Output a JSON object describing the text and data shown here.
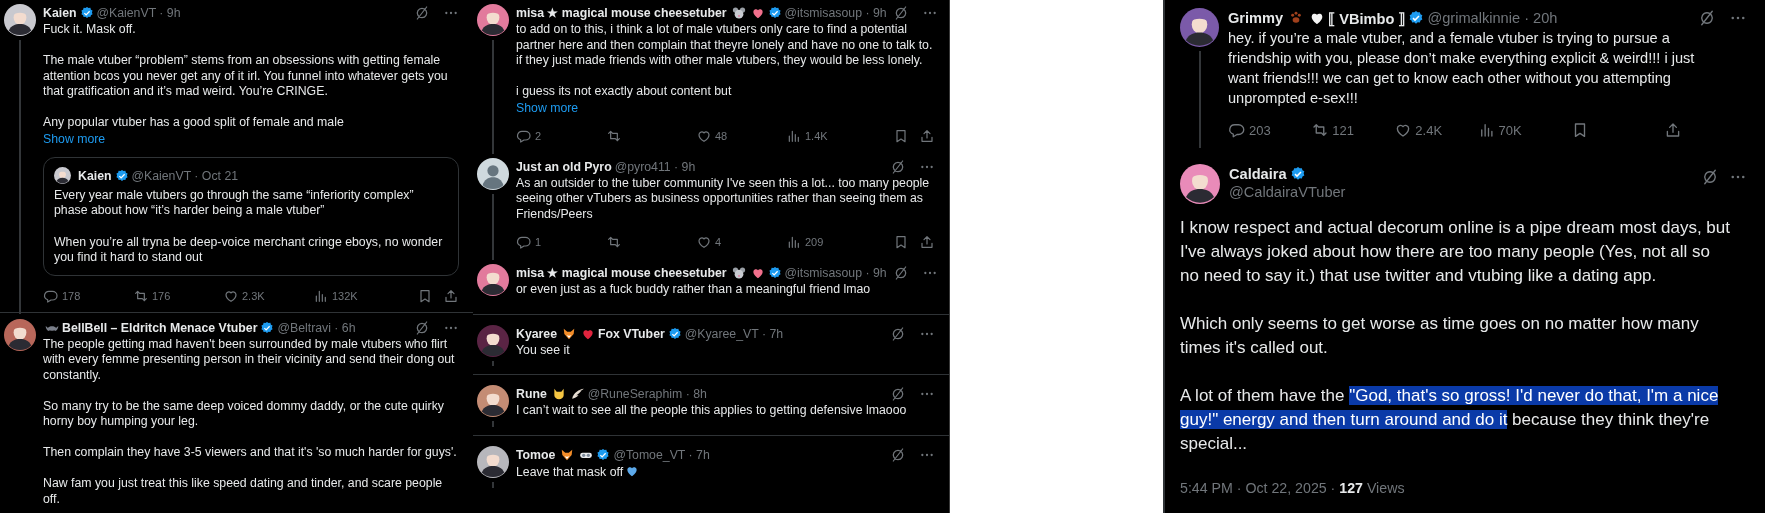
{
  "panels": [
    {
      "tweets": [
        {
          "kind": "compact",
          "border_top": false,
          "thread_line": true,
          "avatar": {
            "kind": "picture",
            "color": "#c9c9cf"
          },
          "name_parts": [
            {
              "kind": "text",
              "text": "Kaien"
            }
          ],
          "verified": true,
          "handle_line": "@KaienVT · 9h",
          "paragraphs": [
            "Fuck it. Mask off.",
            "The male vtuber “problem” stems from an obsessions with getting female attention bcos you never get any of it irl. You funnel into whatever gets you that gratification and it’s mad weird. You’re CRINGE.",
            "Any popular vtuber has a good split of female and male"
          ],
          "show_more": "Show more",
          "quote": {
            "avatar": {
              "kind": "picture",
              "color": "#c9c9cf"
            },
            "name": "Kaien",
            "verified": true,
            "handle_line": "@KaienVT · Oct 21",
            "paragraphs": [
              "Every year male vtubers go through the same “inferiority complex” phase about how “it’s harder being a male vtuber”",
              "When you’re all tryna be deep-voice merchant cringe eboys, no wonder you find it hard to stand out"
            ]
          },
          "actions": {
            "reply": "178",
            "retweet": "176",
            "like": "2.3K",
            "views": "132K"
          }
        },
        {
          "kind": "compact",
          "border_top": true,
          "thread_line": false,
          "avatar": {
            "kind": "picture",
            "color": "#b8675a"
          },
          "name_parts": [
            {
              "kind": "bat"
            },
            {
              "kind": "text",
              "text": "BellBell – Eldritch Menace Vtuber"
            }
          ],
          "verified": true,
          "handle_line": "@Beltravi · 6h",
          "paragraphs": [
            "The people getting mad haven't been surrounded by male vtubers who flirt with every femme presenting person in their vicinity and send their dong out constantly.",
            "So many try to be the same deep voiced dommy daddy, or the cute quirky horny boy humping your leg.",
            "Then complain they have 3-5 viewers and that it's 'so much harder for guys'.",
            "Naw fam you just treat this like speed dating and tinder, and scare people off."
          ]
        }
      ]
    },
    {
      "tweets": [
        {
          "kind": "compact",
          "border_top": false,
          "thread_line": true,
          "avatar": {
            "kind": "picture",
            "color": "#e27a9c"
          },
          "name_parts": [
            {
              "kind": "text",
              "text": "misa ★ magical mouse cheesetuber"
            },
            {
              "kind": "mouse"
            },
            {
              "kind": "pink_heart"
            }
          ],
          "verified": true,
          "handle_line": "@itsmisasoup · 9h",
          "paragraphs": [
            "to add on to this, i think a lot of male vtubers only care to find a potential partner here and then complain that theyre lonely and have no one to talk to. if they just made friends with other male vtubers, they would be less lonely.",
            "i guess its not exactly about content but"
          ],
          "show_more": "Show more",
          "actions": {
            "reply": "2",
            "like": "48",
            "views": "1.4K"
          }
        },
        {
          "kind": "compact",
          "border_top": false,
          "thread_line": true,
          "avatar": {
            "kind": "default",
            "color": "#cfd9de"
          },
          "name_parts": [
            {
              "kind": "text",
              "text": "Just an old Pyro"
            }
          ],
          "verified": false,
          "handle_line": "@pyro411 · 9h",
          "paragraphs": [
            "As an outsider to the tuber community I've seen this a lot... too many people seeing other vTubers as business opportunities rather than seeing them as Friends/Peers"
          ],
          "actions": {
            "reply": "1",
            "like": "4",
            "views": "209"
          }
        },
        {
          "kind": "compact",
          "border_top": false,
          "thread_line": false,
          "avatar": {
            "kind": "picture",
            "color": "#e27a9c"
          },
          "name_parts": [
            {
              "kind": "text",
              "text": "misa ★ magical mouse cheesetuber"
            },
            {
              "kind": "mouse"
            },
            {
              "kind": "pink_heart"
            }
          ],
          "verified": true,
          "handle_line": "@itsmisasoup · 9h",
          "paragraphs": [
            "or even just as a fuck buddy rather than a meaningful friend lmao"
          ]
        },
        {
          "kind": "compact",
          "border_top": true,
          "thread_line": true,
          "avatar": {
            "kind": "picture",
            "color": "#5a2444"
          },
          "name_parts": [
            {
              "kind": "text",
              "text": "Kyaree"
            },
            {
              "kind": "fox"
            },
            {
              "kind": "red_heart"
            },
            {
              "kind": "text",
              "text": "Fox VTuber"
            }
          ],
          "verified": true,
          "handle_line": "@Kyaree_VT · 7h",
          "paragraphs": [
            "You see it"
          ]
        },
        {
          "kind": "compact",
          "border_top": true,
          "thread_line": true,
          "avatar": {
            "kind": "picture",
            "color": "#c48c74"
          },
          "name_parts": [
            {
              "kind": "text",
              "text": "Rune"
            },
            {
              "kind": "cat"
            },
            {
              "kind": "wing"
            }
          ],
          "verified": false,
          "handle_line": "@RuneSeraphim · 8h",
          "paragraphs": [
            "I can’t wait to see all the people this applies to getting defensive lmaooo"
          ]
        },
        {
          "kind": "compact",
          "border_top": true,
          "thread_line": true,
          "avatar": {
            "kind": "picture",
            "color": "#b7b7bc"
          },
          "name_parts": [
            {
              "kind": "text",
              "text": "Tomoe"
            },
            {
              "kind": "fox"
            },
            {
              "kind": "goggles"
            }
          ],
          "verified": true,
          "handle_line": "@Tomoe_VT · 7h",
          "paragraphs": [
            "Leave that mask off"
          ],
          "trailing": [
            {
              "kind": "blue_heart"
            }
          ]
        }
      ]
    },
    {
      "tweets": [
        {
          "kind": "compact",
          "border_top": false,
          "thread_line": true,
          "avatar": {
            "kind": "picture",
            "color": "#7b5aa9"
          },
          "name_parts": [
            {
              "kind": "text",
              "text": "Grimmy"
            },
            {
              "kind": "paw"
            },
            {
              "kind": "white_heart"
            },
            {
              "kind": "text",
              "text": "⟦ VBimbo ⟧"
            }
          ],
          "verified": true,
          "handle_line": "@grimalkinnie · 20h",
          "paragraphs": [
            "hey. if you’re a male vtuber, and a female vtuber is trying to pursue a friendship with you, please don’t make everything explicit & weird!!! i just want friends!!! we can get to know each other without you attempting unprompted e-sex!!!"
          ],
          "actions": {
            "reply": "203",
            "retweet": "121",
            "like": "2.4K",
            "views": "70K"
          }
        },
        {
          "kind": "focal",
          "avatar": {
            "kind": "picture",
            "color": "#e98bb9"
          },
          "name": "Caldaira",
          "verified": true,
          "handle": "@CaldairaVTuber",
          "paragraphs": [
            {
              "segments": [
                {
                  "text": "I know respect and actual decorum online is a pipe dream most days, but I've always joked about how there are too many people (Yes, not all so no need to say it.) that use twitter and vtubing like a dating app.",
                  "highlighted": false
                }
              ]
            },
            {
              "segments": [
                {
                  "text": "Which only seems to get worse as time goes on no matter how many times it's called out.",
                  "highlighted": false
                }
              ]
            },
            {
              "segments": [
                {
                  "text": "A lot of them have the ",
                  "highlighted": false
                },
                {
                  "text": "\"God, that's so gross! I'd never do that, I'm a nice guy!\" energy and then turn around and do it",
                  "highlighted": true
                },
                {
                  "text": " because they think they're special...",
                  "highlighted": false
                }
              ]
            }
          ],
          "stamp": "5:44 PM · Oct 22, 2025 · **127** Views"
        }
      ]
    }
  ]
}
